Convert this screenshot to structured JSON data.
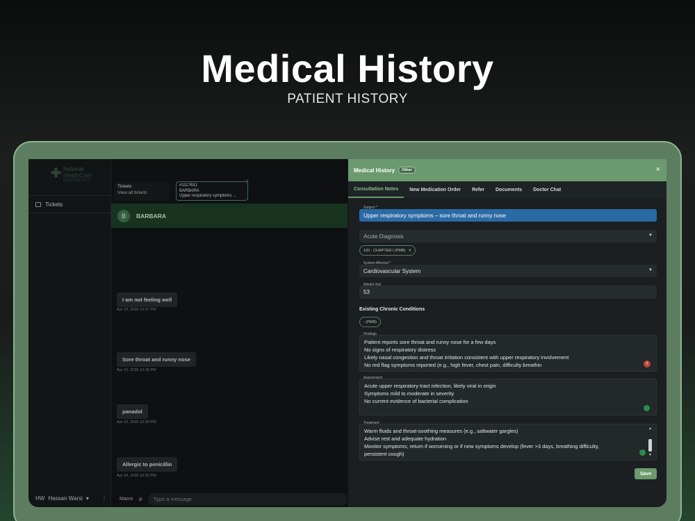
{
  "hero": {
    "title": "Medical History",
    "subtitle": "PATIENT HISTORY"
  },
  "logo": {
    "line1": "National",
    "line2": "HealthCare",
    "line3": "EMERGENCY"
  },
  "sidebar": {
    "tickets_label": "Tickets"
  },
  "user": {
    "initials": "HW",
    "name": "Hassan Warsi",
    "chevron": "▾",
    "more": "⋮"
  },
  "tickets_card": {
    "title": "Tickets",
    "subtitle": "View all tickets"
  },
  "ticket_tag": {
    "id": "#1117631",
    "patient": "BARBARA",
    "summary": "Upper respiratory symptoms ...",
    "close": "×"
  },
  "chat": {
    "avatar": "B",
    "name": "BARBARA",
    "messages": [
      {
        "text": "I am not feeling well",
        "time": "Apr 10, 2026 16:37 PM"
      },
      {
        "text": "Sore throat and runny nose",
        "time": "Apr 10, 2026 16:38 PM"
      },
      {
        "text": "panadol",
        "time": "Apr 10, 2026 16:39 PM"
      },
      {
        "text": "Allergic to penicillin",
        "time": "Apr 10, 2026 16:39 PM"
      }
    ],
    "macro": "Macro",
    "placeholder": "Type a message"
  },
  "modal": {
    "title": "Medical History",
    "badge": "Other",
    "close": "×",
    "tabs": [
      "Consultation Notes",
      "New Medication Order",
      "Refer",
      "Documents",
      "Doctor Chat"
    ],
    "subject_label": "Subject *",
    "subject_value": "Upper respiratory symptoms – sore throat and runny nose",
    "acute_placeholder": "Acute Diagnosis",
    "acute_chip": "100 - CHAPTER I (PMB)",
    "system_label": "System Affected *",
    "system_value": "Cardiovascular System",
    "weight_label": "Weight (kg)",
    "weight_value": "53",
    "chronic_title": "Existing Chronic Conditions",
    "chronic_chip": "- (PMB)",
    "findings_label": "Findings",
    "findings": [
      "Patient reports sore throat and runny nose for a few days",
      "No signs of respiratory distress",
      "Likely nasal congestion and throat irritation consistent with upper respiratory involvement",
      "No red flag symptoms reported (e.g., high fever, chest pain, difficulty breathin"
    ],
    "assessment_label": "Assessment",
    "assessment": [
      "Acute upper respiratory tract infection, likely viral in origin",
      "Symptoms mild to moderate in severity",
      "No current evidence of bacterial complication"
    ],
    "treatment_label": "Treatment",
    "treatment": [
      "Warm fluids and throat-soothing measures (e.g., saltwater gargles)",
      "Advise rest and adequate hydration",
      "Monitor symptoms; return if worsening or if new symptoms develop (fever >3 days, breathing difficulty,",
      "persistent cough)"
    ],
    "save_label": "Save"
  }
}
